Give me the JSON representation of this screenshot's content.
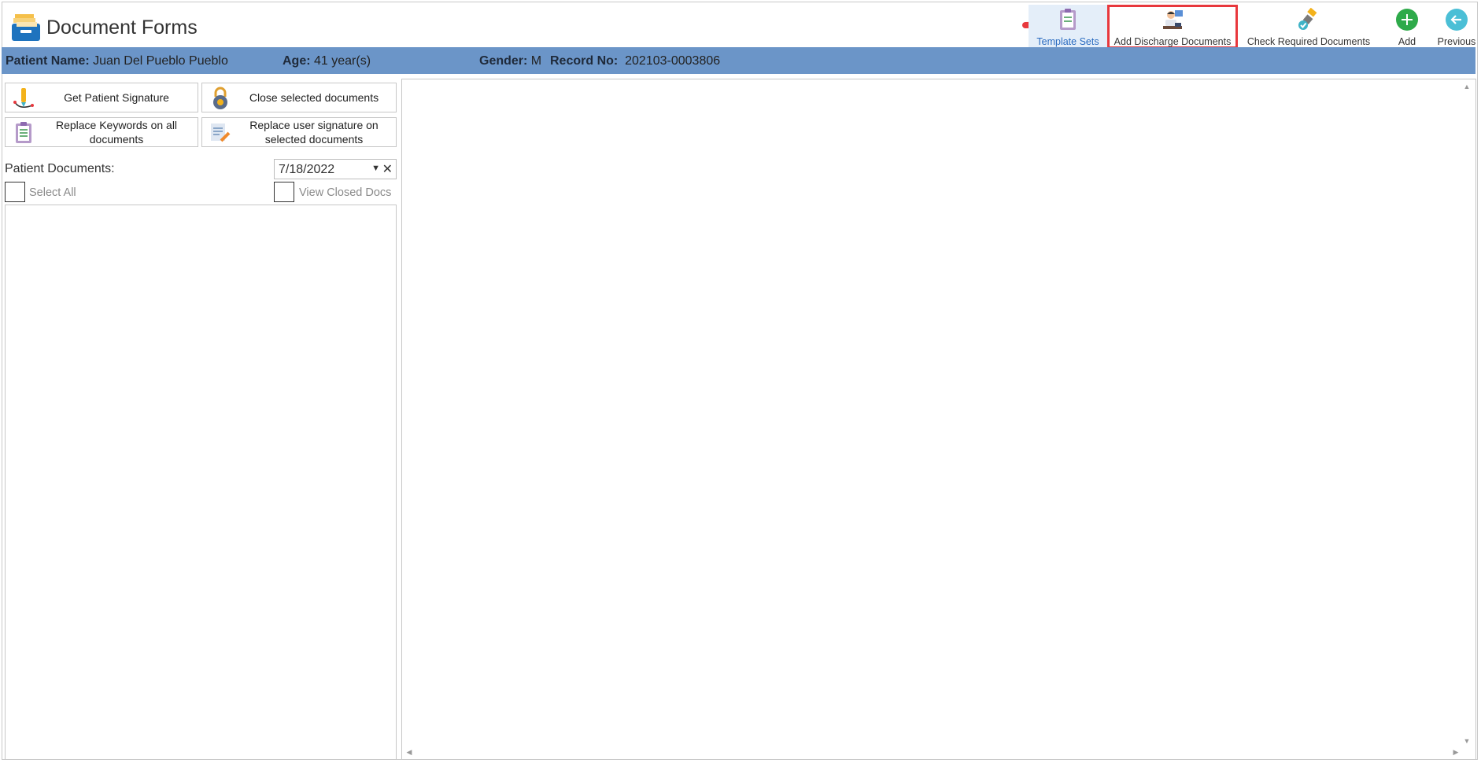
{
  "app": {
    "title": "Document Forms",
    "logo_icon": "file-cabinet-icon"
  },
  "toolbar": {
    "template_sets": {
      "label": "Template Sets",
      "icon": "clipboard-list-icon"
    },
    "add_discharge": {
      "label": "Add Discharge Documents",
      "icon": "doctor-desk-icon"
    },
    "check_required": {
      "label": "Check Required Documents",
      "icon": "satellite-check-icon"
    },
    "add": {
      "label": "Add",
      "icon": "plus-circle-icon"
    },
    "previous": {
      "label": "Previous",
      "icon": "arrow-left-circle-icon"
    }
  },
  "patient": {
    "name_label": "Patient Name:",
    "name": "Juan Del Pueblo Pueblo",
    "age_label": "Age:",
    "age": "41 year(s)",
    "gender_label": "Gender:",
    "gender": "M",
    "record_label": "Record No:",
    "record": "202103-0003806"
  },
  "actions": {
    "get_signature": "Get Patient Signature",
    "close_selected": "Close selected documents",
    "replace_keywords": "Replace Keywords on all documents",
    "replace_user_signature": "Replace user signature on selected documents"
  },
  "documents": {
    "label": "Patient Documents:",
    "date": "7/18/2022",
    "select_all": "Select All",
    "view_closed": "View Closed Docs",
    "items": []
  },
  "colors": {
    "patient_bar": "#6b95c8",
    "highlight": "#e8383d",
    "add_green": "#2eaa4a",
    "previous_teal": "#4bbfd6"
  }
}
